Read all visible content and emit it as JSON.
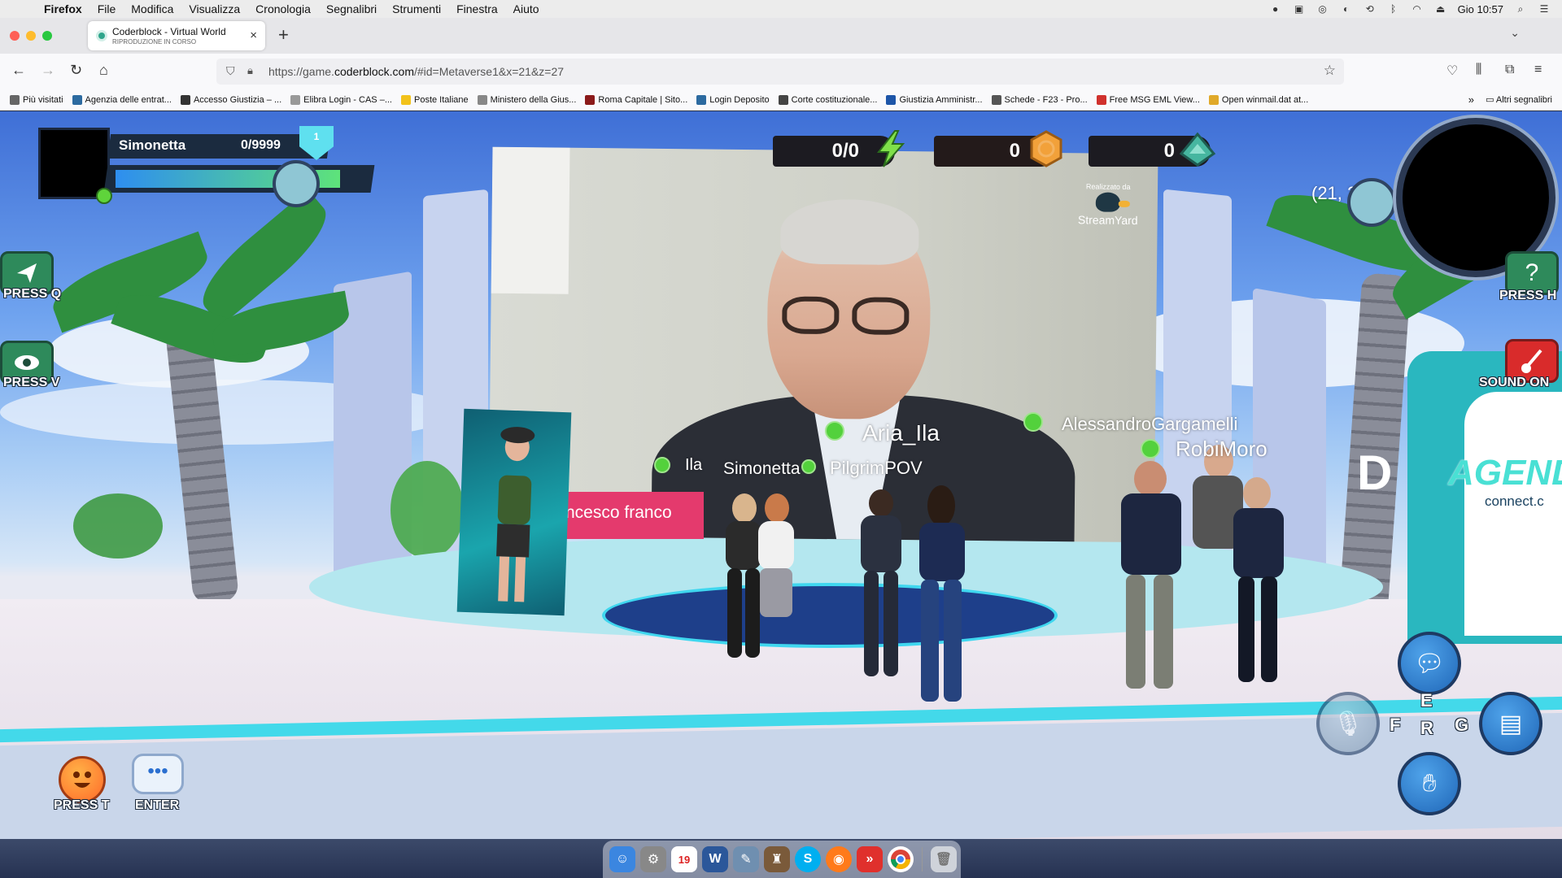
{
  "menubar": {
    "app": "Firefox",
    "items": [
      "File",
      "Modifica",
      "Visualizza",
      "Cronologia",
      "Segnalibri",
      "Strumenti",
      "Finestra",
      "Aiuto"
    ],
    "clock": "Gio 10:57"
  },
  "tab": {
    "title": "Coderblock - Virtual World",
    "subtitle": "RIPRODUZIONE IN CORSO",
    "close": "×"
  },
  "newtab": "+",
  "nav": {
    "url_prefix": "https://game.",
    "url_domain": "coderblock.com",
    "url_suffix": "/#id=Metaverse1&x=21&z=27"
  },
  "bookmarks": {
    "items": [
      {
        "label": "Più visitati",
        "color": "#666"
      },
      {
        "label": "Agenzia delle entrat...",
        "color": "#2c6aa0"
      },
      {
        "label": "Accesso Giustizia – ...",
        "color": "#333"
      },
      {
        "label": "Elibra Login - CAS –...",
        "color": "#999"
      },
      {
        "label": "Poste Italiane",
        "color": "#f2c21b"
      },
      {
        "label": "Ministero della Gius...",
        "color": "#888"
      },
      {
        "label": "Roma Capitale | Sito...",
        "color": "#8b1a1a"
      },
      {
        "label": "Login Deposito",
        "color": "#2c6aa0"
      },
      {
        "label": "Corte costituzionale...",
        "color": "#444"
      },
      {
        "label": "Giustizia Amministr...",
        "color": "#1d55a8"
      },
      {
        "label": "Schede - F23 - Pro...",
        "color": "#555"
      },
      {
        "label": "Free MSG EML View...",
        "color": "#d0312d"
      },
      {
        "label": "Open winmail.dat at...",
        "color": "#e0a92a"
      }
    ],
    "more": "»",
    "other": "Altri segnalibri"
  },
  "hud": {
    "player_name": "Simonetta",
    "xp": "0/9999",
    "level": "1",
    "xp_fraction": 0.92,
    "energy": "0/0",
    "coins": "0",
    "gems": "0",
    "coords": "(21, 27)"
  },
  "controls": {
    "press_q": "PRESS Q",
    "press_v": "PRESS V",
    "press_h": "PRESS H",
    "sound_on": "SOUND ON",
    "press_t": "PRESS T",
    "enter": "ENTER",
    "key_f": "F",
    "key_e": "E",
    "key_r": "R",
    "key_g": "G"
  },
  "stage": {
    "streamyard_small": "Realizzato da",
    "streamyard_brand": "StreamYard",
    "nameplate": "ncesco franco"
  },
  "booth": {
    "brand": "AGENDA",
    "site": "connect.c",
    "partial_letter": "D"
  },
  "avatars": [
    {
      "name": "Aria_Ila"
    },
    {
      "name": "AlessandroGargamelli"
    },
    {
      "name": "RobiMoro"
    },
    {
      "name": "Ila"
    },
    {
      "name": "Simonetta"
    },
    {
      "name": "PilgrimPOV"
    }
  ],
  "dock": {
    "calendar_day": "19"
  },
  "colors": {
    "accent_green": "#53d13c",
    "nameplate_pink": "#e43a6d",
    "hud_dark": "#1b2b3f"
  }
}
